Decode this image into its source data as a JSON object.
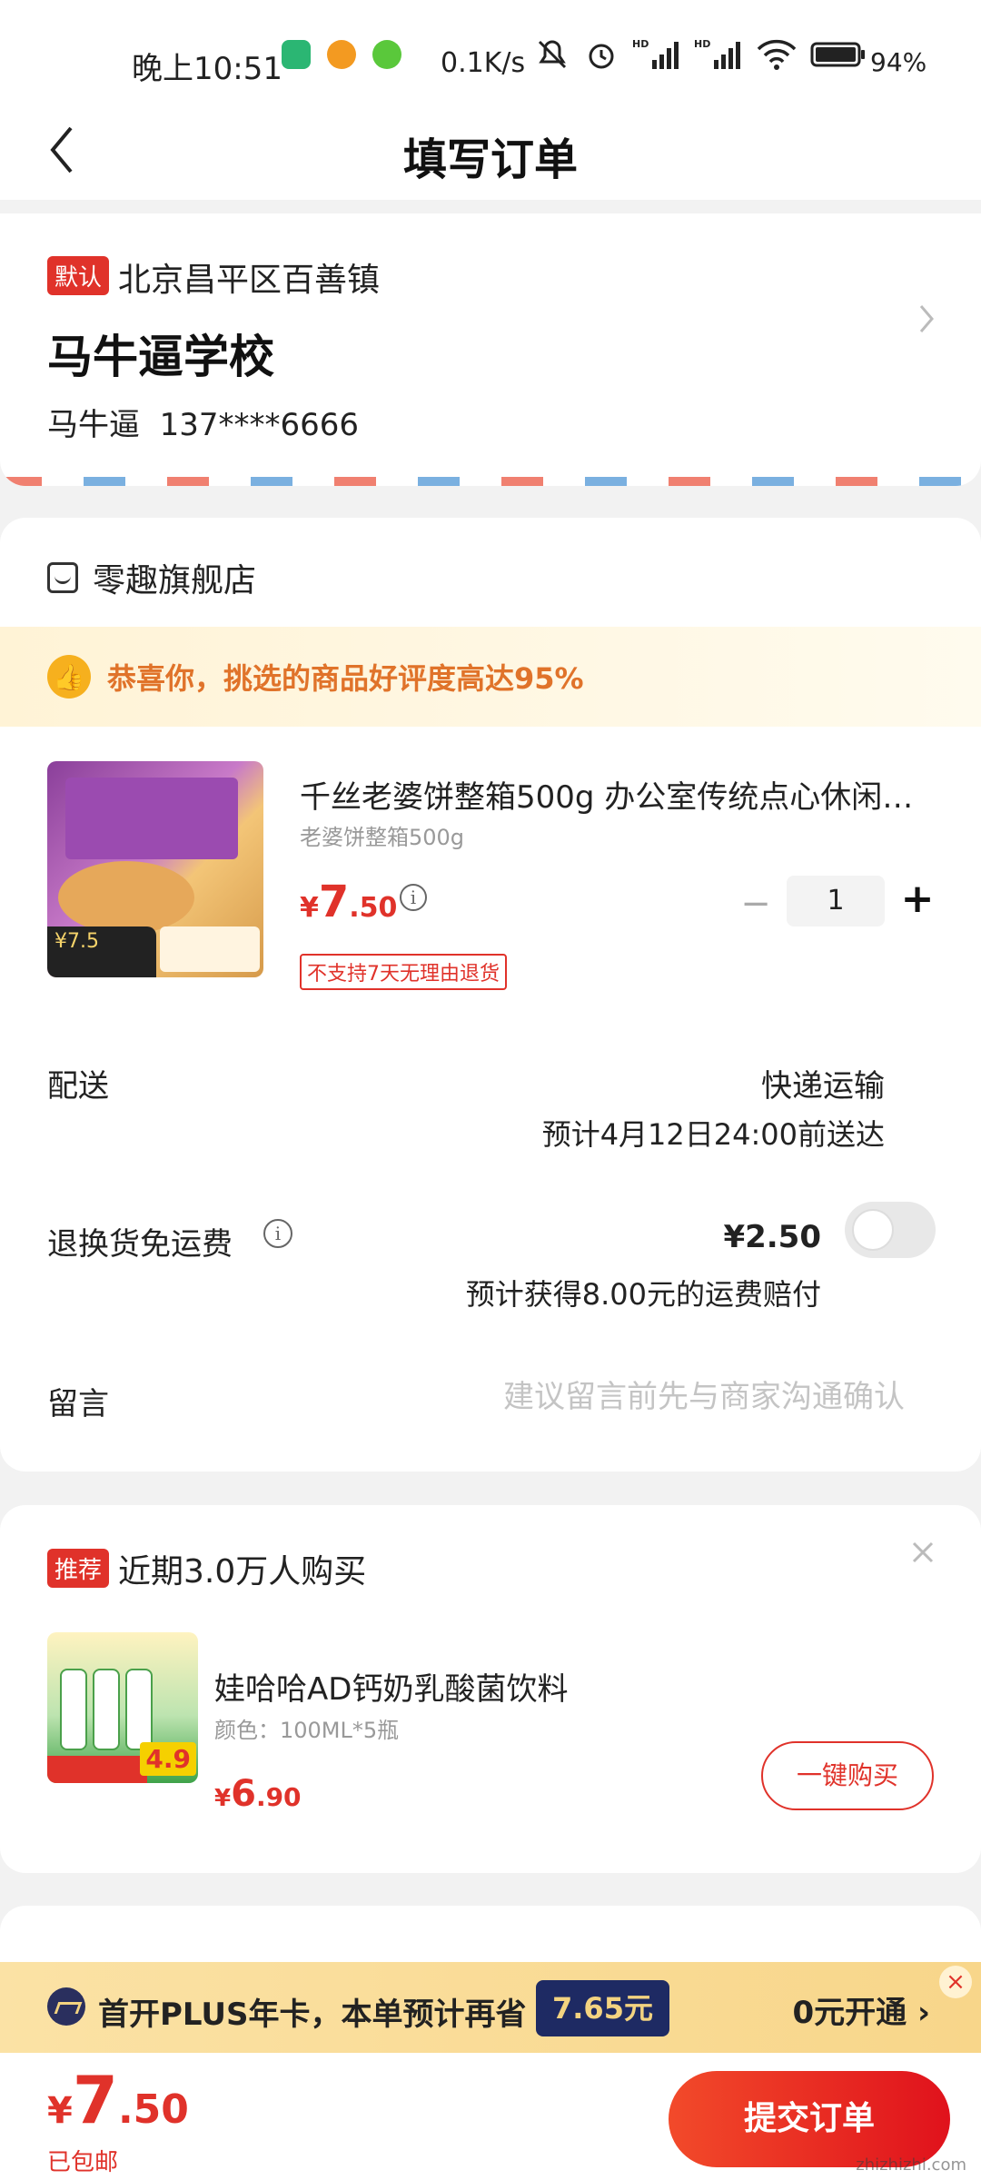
{
  "status_bar": {
    "time": "晚上10:51",
    "net_speed": "0.1K/s",
    "battery": "94%"
  },
  "header": {
    "title": "填写订单"
  },
  "address": {
    "default_tag": "默认",
    "region": "北京昌平区百善镇",
    "detail": "马牛逼学校",
    "contact_name": "马牛逼",
    "contact_phone": "137****6666"
  },
  "store": {
    "name": "零趣旗舰店",
    "praise": "恭喜你，挑选的商品好评度高达95%",
    "product": {
      "title": "千丝老婆饼整箱500g 办公室传统点心休闲…",
      "spec": "老婆饼整箱500g",
      "price_currency": "¥",
      "price_int": "7",
      "price_dec": ".50",
      "image_price": "7.5",
      "quantity": "1",
      "no_return_tag": "不支持7天无理由退货"
    },
    "delivery": {
      "label": "配送",
      "method": "快递运输",
      "eta": "预计4月12日24:00前送达"
    },
    "freight_insurance": {
      "label": "退换货免运费",
      "price": "¥2.50",
      "compensation": "预计获得8.00元的运费赔付",
      "enabled": false
    },
    "message": {
      "label": "留言",
      "placeholder": "建议留言前先与商家沟通确认"
    }
  },
  "recommend": {
    "tag": "推荐",
    "title": "近期3.0万人购买",
    "product": {
      "name": "娃哈哈AD钙奶乳酸菌饮料",
      "spec": "颜色：100ML*5瓶",
      "price_currency": "¥",
      "price_int": "6",
      "price_dec": ".90",
      "image_price": "4.9"
    },
    "buy_button": "一键购买"
  },
  "plus_banner": {
    "text": "首开PLUS年卡，本单预计再省",
    "amount": "7.65元",
    "action": "0元开通"
  },
  "bottom_bar": {
    "price_currency": "¥",
    "price_int": "7",
    "price_dec": ".50",
    "shipping_note": "已包邮",
    "submit": "提交订单"
  },
  "watermark": "zhizhizhi.com",
  "colors": {
    "accent": "#e0322a",
    "praise": "#e0732a",
    "plus_bg": "#f8d68a",
    "plus_amount_bg": "#1e2a63"
  }
}
